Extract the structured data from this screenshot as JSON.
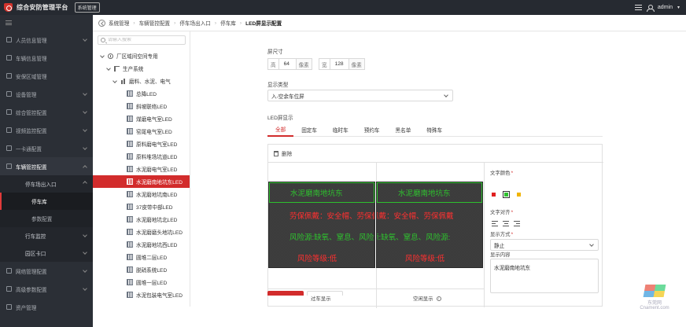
{
  "header": {
    "app_title": "综合安防管理平台",
    "system_button": "系统管理",
    "user": "admin"
  },
  "sidebar": {
    "items": [
      {
        "label": "人员信息管理"
      },
      {
        "label": "车辆信息管理"
      },
      {
        "label": "安保区域管理"
      },
      {
        "label": "设备管理"
      },
      {
        "label": "综合管控配置"
      },
      {
        "label": "视频监控配置"
      },
      {
        "label": "一卡通配置"
      },
      {
        "label": "车辆管控配置"
      }
    ],
    "sub_parking_io": "停车场出入口",
    "sub_garage": "停车库",
    "sub_params": "参数配置",
    "sub_traffic": "行车监控",
    "sub_gate": "园区卡口",
    "more_items": [
      {
        "label": "网络管理配置"
      },
      {
        "label": "高级参数配置"
      },
      {
        "label": "资产管理"
      }
    ]
  },
  "breadcrumb": {
    "items": [
      "系统管理",
      "车辆管控配置",
      "停车场出入口",
      "停车库",
      "LED屏显示配置"
    ]
  },
  "tree": {
    "search_placeholder": "请输入搜索",
    "root": "厂区域间空间专用",
    "system": "生产系统",
    "garage": "磨料、水泥、电气",
    "leds": [
      "总降LED",
      "斜坡联络LED",
      "煤磨电气室LED",
      "窑尾电气室LED",
      "原料磨电气室LED",
      "原料堆场坑道LED",
      "水泥磨电气室LED",
      "水泥磨南地坑东LED",
      "水泥磨地坑南LED",
      "37皮带中部LED",
      "水泥磨地坑北LED",
      "水泥磨磨头地坑LED",
      "水泥磨地坑西LED",
      "圆堆二层LED",
      "脱硝系统LED",
      "圆堆一层LED",
      "水泥包装电气室LED"
    ],
    "active_index": 7
  },
  "main": {
    "screen_size_label": "屏尺寸",
    "height_tag": "高",
    "height_value": "64",
    "width_tag": "宽",
    "width_value": "128",
    "unit": "像素",
    "display_type_label": "显示类型",
    "display_type_value": "入-空余车位屏",
    "led_display_label": "LED屏显示",
    "tabs": [
      "全部",
      "固定车",
      "临时车",
      "预约车",
      "黑名单",
      "特殊车"
    ],
    "delete_label": "删除",
    "preview": {
      "line1": "水泥磨南地坑东",
      "line2": "劳保佩戴：安全帽、劳保佩戴",
      "line3": "风险源:缺氧、窒息、风险源:",
      "line4": "风险等级:低",
      "pass_label": "过车显示",
      "idle_label": "空闲显示"
    },
    "text_color_label": "文字颜色",
    "text_align_label": "文字对齐",
    "display_mode_label": "显示方式",
    "display_mode_value": "静止",
    "display_content_label": "显示内容",
    "display_content_value": "水泥磨南地坑东"
  },
  "colors": {
    "accent": "#d22c2c",
    "swatch_red": "#e02020",
    "swatch_green": "#2ec02e",
    "swatch_yellow": "#f0b400",
    "led_green": "#2ec02e",
    "led_red": "#ff3030"
  },
  "watermark": {
    "line1": "东莞网",
    "line2": "Cnament.com"
  }
}
